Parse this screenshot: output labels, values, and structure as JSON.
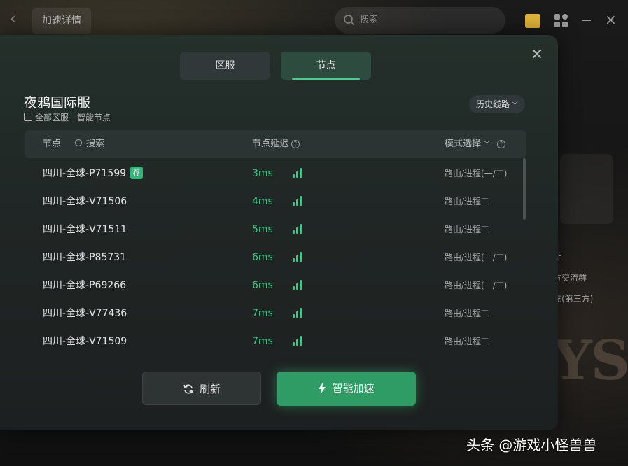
{
  "app": {
    "top_title": "加速详情",
    "search_placeholder": "搜索"
  },
  "background_side": {
    "lines": [
      "址",
      "方交流群",
      "充(第三方)"
    ],
    "logo_text": "YS"
  },
  "modal": {
    "tabs": [
      {
        "label": "区服",
        "active": false
      },
      {
        "label": "节点",
        "active": true
      }
    ],
    "game_title": "夜鸦国际服",
    "sub_info": "全部区服 - 智能节点",
    "history_button": "历史线路"
  },
  "table": {
    "headers": {
      "node": "节点",
      "search": "搜索",
      "delay": "节点延迟",
      "mode": "模式选择"
    },
    "rows": [
      {
        "name": "四川-全球-P71599",
        "badge": "荐",
        "latency": "3ms",
        "mode": "路由/进程(一/二)"
      },
      {
        "name": "四川-全球-V71506",
        "badge": "",
        "latency": "4ms",
        "mode": "路由/进程二"
      },
      {
        "name": "四川-全球-V71511",
        "badge": "",
        "latency": "5ms",
        "mode": "路由/进程二"
      },
      {
        "name": "四川-全球-P85731",
        "badge": "",
        "latency": "6ms",
        "mode": "路由/进程(一/二)"
      },
      {
        "name": "四川-全球-P69266",
        "badge": "",
        "latency": "6ms",
        "mode": "路由/进程(一/二)"
      },
      {
        "name": "四川-全球-V77436",
        "badge": "",
        "latency": "7ms",
        "mode": "路由/进程二"
      },
      {
        "name": "四川-全球-V71509",
        "badge": "",
        "latency": "7ms",
        "mode": "路由/进程二"
      }
    ]
  },
  "actions": {
    "refresh": "刷新",
    "smart_accelerate": "智能加速"
  },
  "watermark": "头条 @游戏小怪兽兽",
  "colors": {
    "accent": "#3ecb8a",
    "primary_button": "#2f9c66"
  }
}
